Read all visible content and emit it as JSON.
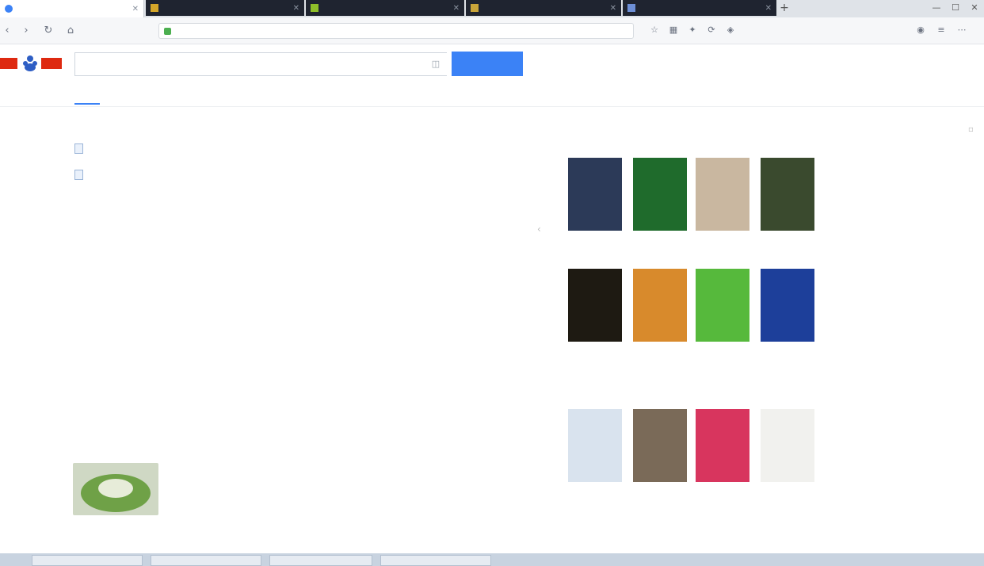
{
  "browser": {
    "tabs": [
      {
        "label": "",
        "active": true
      },
      {
        "label": "",
        "active": false
      },
      {
        "label": "",
        "active": false
      },
      {
        "label": "",
        "active": false
      },
      {
        "label": "",
        "active": false
      }
    ],
    "address": ""
  },
  "search": {
    "query": "",
    "button_label": "",
    "header_links": [
      "",
      "",
      ""
    ],
    "tabs": [
      "",
      "",
      "",
      "",
      "",
      "",
      "",
      "",
      "",
      ""
    ],
    "result_count": "",
    "tools_label": ""
  },
  "related": [
    {
      "label": "",
      "links": [
        "",
        "",
        "",
        ""
      ]
    },
    {
      "label": "",
      "links": [
        ""
      ]
    }
  ],
  "results": [
    {
      "title": "",
      "lines": [
        "",
        "",
        ""
      ],
      "url": ""
    },
    {
      "title": "",
      "lines": [
        "",
        "",
        ""
      ],
      "url": ""
    },
    {
      "title": "",
      "lines": [
        "",
        "",
        ""
      ],
      "url": ""
    },
    {
      "title": "",
      "lines": [
        "",
        "",
        ""
      ],
      "url": ""
    },
    {
      "title": ""
    }
  ],
  "sidebar": {
    "group1_title": "",
    "group2_title": "",
    "group1": [
      {
        "caption": "",
        "color": "#2c3a58"
      },
      {
        "caption": "",
        "color": "#1f6b2c"
      },
      {
        "caption": "",
        "color": "#c9b7a0"
      },
      {
        "caption": "",
        "color": "#3a4a2e"
      },
      {
        "caption": "",
        "color": "#1e1a12"
      },
      {
        "caption": "",
        "color": "#d88a2c"
      },
      {
        "caption": "",
        "color": "#56b93c"
      },
      {
        "caption": "",
        "color": "#1d3f9a"
      }
    ],
    "group2": [
      {
        "caption": "",
        "color": "#d9e3ee"
      },
      {
        "caption": "",
        "color": "#7a6a58"
      },
      {
        "caption": "",
        "color": "#d8355e"
      },
      {
        "caption": "",
        "color": "#f1f1ee"
      }
    ]
  },
  "colors": {
    "accent": "#3b82f6",
    "link": "#2440b3",
    "url": "#008000"
  }
}
